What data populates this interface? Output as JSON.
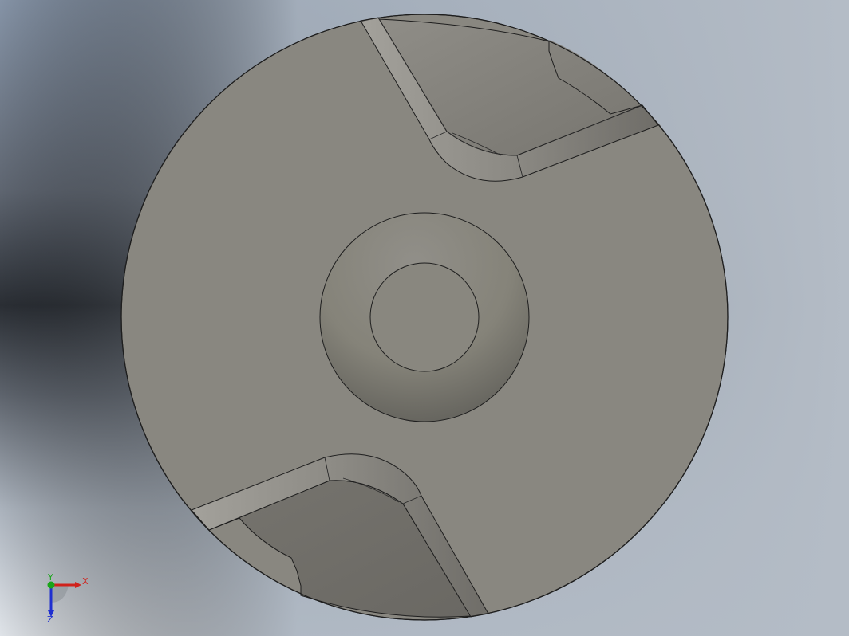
{
  "viewport": {
    "background_top": "#7f8da0",
    "background_mid": "#2b2f35",
    "background_bottom": "#e3e6ea",
    "part_face_color": "#8a8882",
    "part_edge_color": "#1e1e1e"
  },
  "triad": {
    "x_label": "X",
    "y_label": "Y",
    "z_label": "Z",
    "x_color": "#d0221c",
    "y_color": "#1aa51a",
    "z_color": "#1f2fd0"
  }
}
